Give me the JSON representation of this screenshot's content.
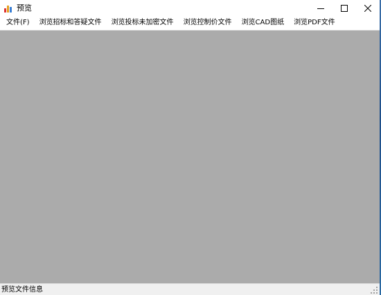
{
  "window": {
    "title": "预览",
    "icon": "chart-app-icon"
  },
  "caption": {
    "minimize_icon": "minimize-icon",
    "maximize_icon": "maximize-icon",
    "close_icon": "close-icon"
  },
  "menu": {
    "items": [
      "文件(F)",
      "浏览招标和答疑文件",
      "浏览投标未加密文件",
      "浏览控制价文件",
      "浏览CAD图纸",
      "浏览PDF文件"
    ]
  },
  "content": {
    "background": "#ababab"
  },
  "status": {
    "text": "预览文件信息"
  }
}
